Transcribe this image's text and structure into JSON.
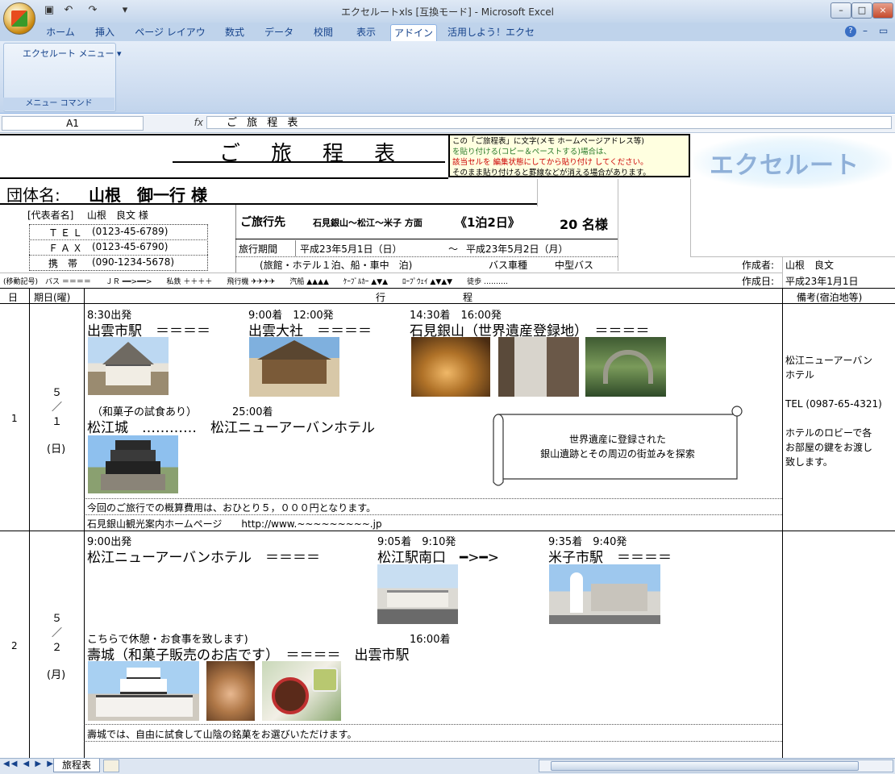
{
  "window": {
    "title": "エクセルートxls [互換モード] - Microsoft Excel",
    "min": "–",
    "max": "□",
    "close": "×"
  },
  "ribbon": {
    "tabs": [
      "ホーム",
      "挿入",
      "ページ レイアウト",
      "数式",
      "データ",
      "校閲",
      "表示",
      "アドイン",
      "活用しよう！エクセル"
    ],
    "active_tab": "アドイン",
    "group_menu": "エクセルート メニュー ▾",
    "group_label": "メニュー コマンド"
  },
  "formula_bar": {
    "name_box": "A1",
    "fx": "fx",
    "content": "ご 旅 程 表"
  },
  "sheet": {
    "title": "ご　旅　程　表",
    "note_lines": [
      "この「ご旅程表」に文字(メモ ホームページアドレス等)",
      "を貼り付ける(コピー＆ペーストする)場合は、",
      "該当セルを  編集状態にしてから貼り付け  してください。",
      "そのまま貼り付けると罫線などが消える場合があります。"
    ],
    "logo": "エクセルート",
    "group_label": "団体名:",
    "group_name": "山根　御一行 様",
    "rep_label": "[代表者名]",
    "rep_name": "山根　良文 様",
    "tel_label": "ＴＥＬ",
    "tel": "(0123-45-6789)",
    "fax_label": "ＦＡＸ",
    "fax": "(0123-45-6790)",
    "mobile_label": "携　帯",
    "mobile": "(090-1234-5678)",
    "dest_label": "ご旅行先",
    "dest": "石見銀山～松江～米子 方面",
    "nights": "《1泊2日》",
    "people": "20 名様",
    "period_label": "旅行期間",
    "period_start": "平成23年5月1日（日）",
    "period_sep": "～",
    "period_end": "平成23年5月2日（月）",
    "lodging": "(旅館・ホテル１泊、船・車中　泊)",
    "bus_label": "バス車種",
    "bus_type": "中型バス",
    "author_label": "作成者:",
    "author": "山根　良文",
    "created_label": "作成日:",
    "created": "平成23年1月1日",
    "legend": "(移動記号)　バス ＝＝＝＝　　ＪＲ ━━>━━>　　私鉄 ＋＋＋＋　　飛行機 ✈✈✈✈　　汽船 ▲▲▲▲　　ｹｰﾌﾞﾙｶｰ ▲▼▲　　ﾛｰﾌﾟｳｪｲ ▲▼▲▼　　徒歩 ‥‥‥‥‥",
    "headers": {
      "day": "日",
      "date": "期日(曜)",
      "schedule": "行　　　　　　　　程",
      "remarks": "備考(宿泊地等)"
    }
  },
  "day1": {
    "num": "1",
    "month": "５",
    "slash": "／",
    "day": "１",
    "weekday": "(日)",
    "t1": "8:30出発",
    "p1": "出雲市駅　＝＝＝＝",
    "t2": "9:00着　12:00発",
    "p2": "出雲大社　＝＝＝＝",
    "t3": "14:30着　16:00発",
    "p3": "石見銀山（世界遺産登録地）　＝＝＝＝",
    "t4": "（和菓子の試食あり）",
    "t5": "25:00着",
    "p4": "松江城　…………　松江ニューアーバンホテル",
    "scroll1": "世界遺産に登録された",
    "scroll2": "銀山遺跡とその周辺の街並みを探索",
    "note1": "今回のご旅行での概算費用は、おひとり５，０００円となります。",
    "note2": "石見銀山観光案内ホームページ　　http://www.~~~~~~~~~.jp",
    "remark1": "松江ニューアーバン",
    "remark2": "ホテル",
    "remark3": "TEL (0987-65-4321)",
    "remark4": "ホテルのロビーで各",
    "remark5": "お部屋の鍵をお渡し",
    "remark6": "致します。"
  },
  "day2": {
    "num": "2",
    "month": "５",
    "slash": "／",
    "day": "２",
    "weekday": "(月)",
    "t1": "9:00出発",
    "p1": "松江ニューアーバンホテル　＝＝＝＝",
    "t2": "9:05着　9:10発",
    "p2": "松江駅南口　━>━>",
    "t3": "9:35着　9:40発",
    "p3": "米子市駅　＝＝＝＝",
    "t4": "こちらで休憩・お食事を致します)",
    "t5": "16:00着",
    "p4": "壽城（和菓子販売のお店です）　＝＝＝＝　出雲市駅",
    "note1": "壽城では、自由に試食して山陰の銘菓をお選びいただけます。"
  },
  "sheet_tab": "旅程表",
  "colors": {
    "title_bg": "#c4d6ec",
    "ribbon": "#cddcf0",
    "note_bg": "#ffffe0",
    "logo_bg": "#e6f4fc"
  }
}
